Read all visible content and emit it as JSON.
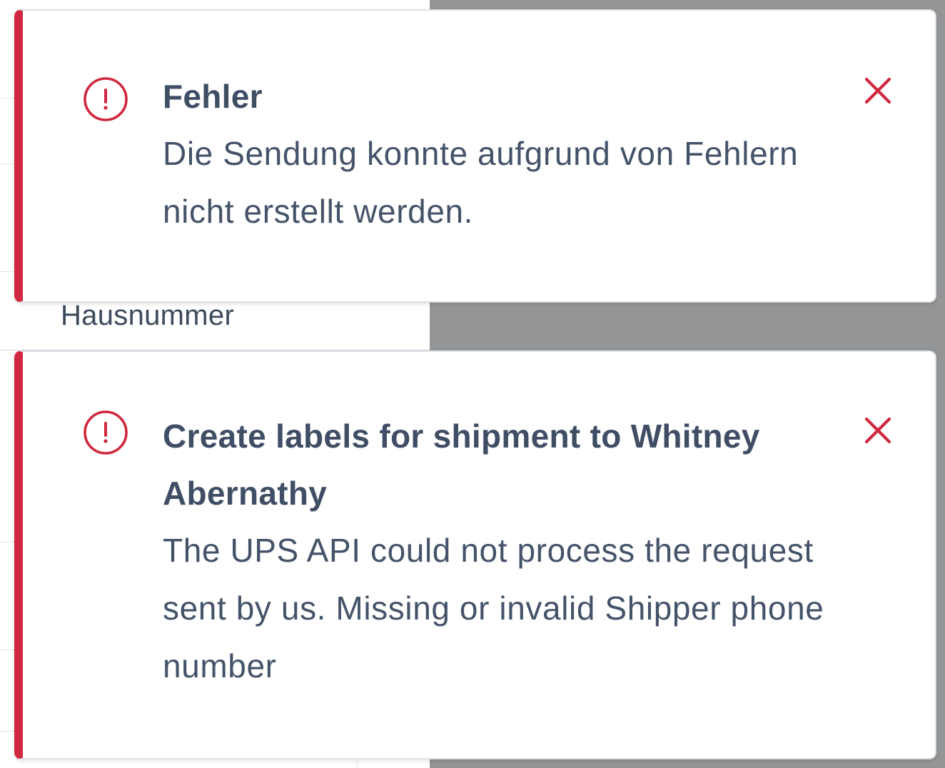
{
  "background": {
    "field_label": "Hausnummer"
  },
  "notifications": [
    {
      "title": "Fehler",
      "message": "Die Sendung konnte aufgrund von Fehlern nicht erstellt werden.",
      "icon": "error-circle-icon",
      "close_icon": "close-icon"
    },
    {
      "title": "Create labels for shipment to Whitney Abernathy",
      "message": "The UPS API could not process the request sent by us. Missing or invalid Shipper phone number",
      "icon": "error-circle-icon",
      "close_icon": "close-icon"
    }
  ],
  "colors": {
    "accent": "#d0283e",
    "title": "#3f4e65",
    "text": "#445369",
    "overlay": "#939597"
  }
}
